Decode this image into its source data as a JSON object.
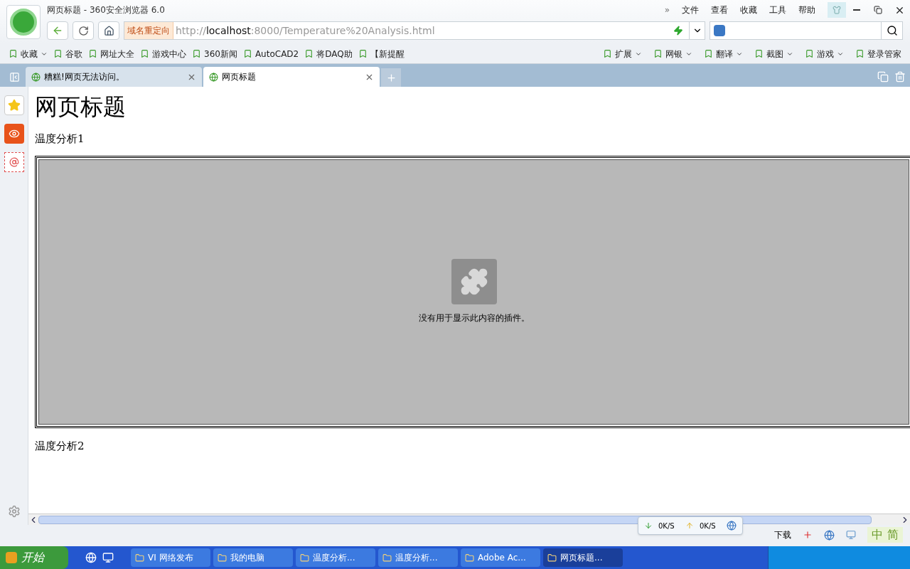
{
  "window": {
    "title": "网页标题 - 360安全浏览器 6.0",
    "more": "»",
    "menu": [
      "文件",
      "查看",
      "收藏",
      "工具",
      "帮助"
    ]
  },
  "address_bar": {
    "badge": "域名重定向",
    "url_prefix": "http://",
    "url_host": "localhost",
    "url_rest": ":8000/Temperature%20Analysis.html"
  },
  "bookmarks_left": [
    {
      "label": "收藏",
      "kind": "menu"
    },
    {
      "label": "谷歌",
      "kind": "link"
    },
    {
      "label": "网址大全",
      "kind": "link"
    },
    {
      "label": "游戏中心",
      "kind": "link"
    },
    {
      "label": "360新闻",
      "kind": "link"
    },
    {
      "label": "AutoCAD2",
      "kind": "link"
    },
    {
      "label": "将DAQ助",
      "kind": "link"
    },
    {
      "label": "【新提醒",
      "kind": "link"
    }
  ],
  "bookmarks_right": [
    {
      "label": "扩展",
      "kind": "menu"
    },
    {
      "label": "网银",
      "kind": "menu"
    },
    {
      "label": "翻译",
      "kind": "menu"
    },
    {
      "label": "截图",
      "kind": "menu"
    },
    {
      "label": "游戏",
      "kind": "menu"
    },
    {
      "label": "登录管家",
      "kind": "link"
    }
  ],
  "tabs": [
    {
      "label": "糟糕!网页无法访问。",
      "selected": false
    },
    {
      "label": "网页标题",
      "selected": true
    }
  ],
  "page": {
    "heading": "网页标题",
    "caption_1": "温度分析1",
    "plugin_message": "没有用于显示此内容的插件。",
    "caption_2": "温度分析2"
  },
  "status_bar": {
    "down_speed": "0K/S",
    "up_speed": "0K/S",
    "downloads": "下载",
    "ime_mode": "中",
    "ime_script": "简"
  },
  "taskbar": {
    "start": "开始",
    "windows": [
      {
        "label": "VI 网络发布",
        "selected": false
      },
      {
        "label": "我的电脑",
        "selected": false
      },
      {
        "label": "温度分析...",
        "selected": false
      },
      {
        "label": "温度分析...",
        "selected": false
      },
      {
        "label": "Adobe Ac...",
        "selected": false
      },
      {
        "label": "网页标题...",
        "selected": true
      }
    ]
  }
}
